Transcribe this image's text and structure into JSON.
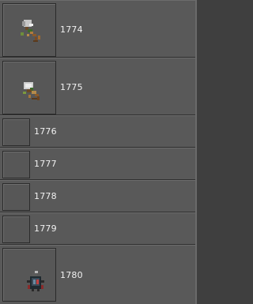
{
  "items": [
    {
      "label": "1774",
      "icon": "axe-creature-sprite-icon",
      "has_sprite": true
    },
    {
      "label": "1775",
      "icon": "hammer-creature-sprite-icon",
      "has_sprite": true
    },
    {
      "label": "1776",
      "icon": "empty-slot-icon",
      "has_sprite": false
    },
    {
      "label": "1777",
      "icon": "empty-slot-icon",
      "has_sprite": false
    },
    {
      "label": "1778",
      "icon": "empty-slot-icon",
      "has_sprite": false
    },
    {
      "label": "1779",
      "icon": "empty-slot-icon",
      "has_sprite": false
    },
    {
      "label": "1780",
      "icon": "beetle-creature-sprite-icon",
      "has_sprite": true
    }
  ],
  "colors": {
    "row_bg": "#595959",
    "border_dark": "#2f2f2f",
    "text": "#f0f0f0"
  }
}
